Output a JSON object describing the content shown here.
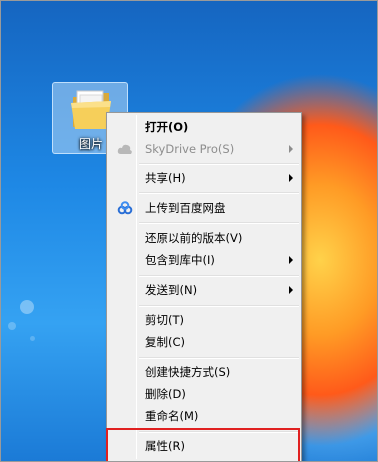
{
  "desktop": {
    "icon_label": "图片"
  },
  "context_menu": {
    "items": [
      {
        "label": "打开(O)",
        "bold": true
      },
      {
        "label": "SkyDrive Pro(S)",
        "disabled": true,
        "submenu": true
      },
      {
        "label": "共享(H)",
        "submenu": true
      },
      {
        "label": "上传到百度网盘"
      },
      {
        "label": "还原以前的版本(V)"
      },
      {
        "label": "包含到库中(I)",
        "submenu": true
      },
      {
        "label": "发送到(N)",
        "submenu": true
      },
      {
        "label": "剪切(T)"
      },
      {
        "label": "复制(C)"
      },
      {
        "label": "创建快捷方式(S)"
      },
      {
        "label": "删除(D)"
      },
      {
        "label": "重命名(M)"
      },
      {
        "label": "属性(R)"
      }
    ]
  },
  "annotation": {
    "highlight_color": "#e02020"
  },
  "icons": {
    "folder": "folder-icon",
    "skydrive": "cloud-icon",
    "baidu": "baidu-netdisk-icon"
  }
}
